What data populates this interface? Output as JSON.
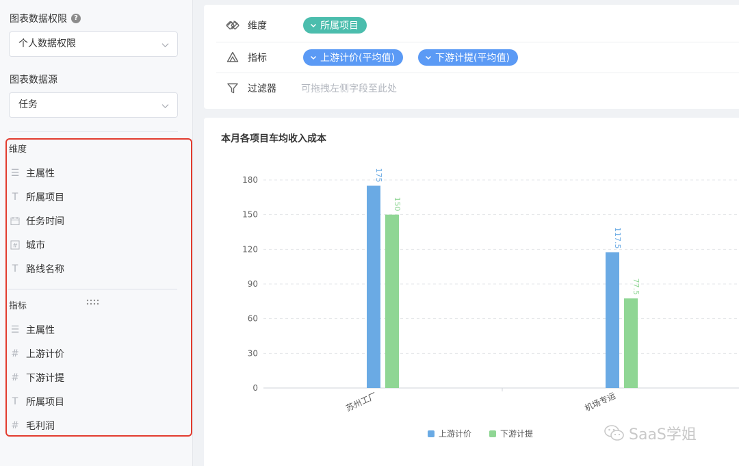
{
  "left_panel": {
    "permission_label": "图表数据权限",
    "permission_value": "个人数据权限",
    "source_label": "图表数据源",
    "source_value": "任务",
    "dimension_title": "维度",
    "dimension_fields": [
      {
        "label": "主属性",
        "icon": "list-icon"
      },
      {
        "label": "所属项目",
        "icon": "text-icon"
      },
      {
        "label": "任务时间",
        "icon": "calendar-icon"
      },
      {
        "label": "城市",
        "icon": "number-icon"
      },
      {
        "label": "路线名称",
        "icon": "text-icon"
      }
    ],
    "metric_title": "指标",
    "metric_fields": [
      {
        "label": "主属性",
        "icon": "list-icon"
      },
      {
        "label": "上游计价",
        "icon": "hash-icon"
      },
      {
        "label": "下游计提",
        "icon": "hash-icon"
      },
      {
        "label": "所属项目",
        "icon": "text-icon"
      },
      {
        "label": "毛利润",
        "icon": "hash-icon"
      }
    ]
  },
  "config": {
    "dimension_label": "维度",
    "dimension_pills": [
      "所属项目"
    ],
    "metric_label": "指标",
    "metric_pills": [
      "上游计价(平均值)",
      "下游计提(平均值)"
    ],
    "filter_label": "过滤器",
    "filter_placeholder": "可拖拽左侧字段至此处"
  },
  "colors": {
    "teal_pill": "#4bbdad",
    "blue_pill": "#5b9af5",
    "series_upstream": "#6aaae4",
    "series_downstream": "#8fd694",
    "highlight_border": "#e23b2e"
  },
  "chart_data": {
    "type": "bar",
    "title": "本月各项目车均收入成本",
    "categories": [
      "苏州工厂",
      "机场专运"
    ],
    "series": [
      {
        "name": "上游计价",
        "values": [
          175,
          117.5
        ],
        "labels": [
          "175",
          "117.5"
        ]
      },
      {
        "name": "下游计提",
        "values": [
          150,
          77.5
        ],
        "labels": [
          "150",
          "77.5"
        ]
      }
    ],
    "ylim": [
      0,
      180
    ],
    "yticks": [
      0,
      30,
      60,
      90,
      120,
      150,
      180
    ],
    "grid": true,
    "legend_position": "bottom"
  },
  "watermark": "SaaS学姐"
}
